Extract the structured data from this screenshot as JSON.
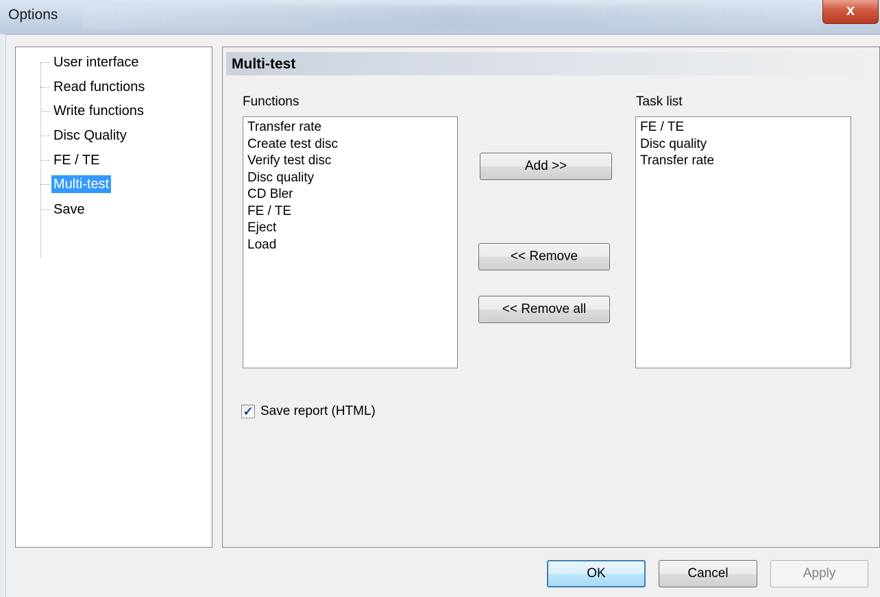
{
  "window": {
    "title": "Options",
    "close_glyph": "x"
  },
  "nav": {
    "items": [
      {
        "label": "User interface",
        "selected": false
      },
      {
        "label": "Read functions",
        "selected": false
      },
      {
        "label": "Write functions",
        "selected": false
      },
      {
        "label": "Disc Quality",
        "selected": false
      },
      {
        "label": "FE / TE",
        "selected": false
      },
      {
        "label": "Multi-test",
        "selected": true
      },
      {
        "label": "Save",
        "selected": false
      }
    ]
  },
  "page": {
    "header": "Multi-test",
    "functions_label": "Functions",
    "functions": [
      "Transfer rate",
      "Create test disc",
      "Verify test disc",
      "Disc quality",
      "CD Bler",
      "FE / TE",
      "Eject",
      "Load"
    ],
    "task_list_label": "Task list",
    "task_list": [
      "FE / TE",
      "Disc quality",
      "Transfer rate"
    ],
    "add_label": "Add >>",
    "remove_label": "<< Remove",
    "remove_all_label": "<< Remove all",
    "save_report_label": "Save report (HTML)",
    "save_report_checked": true
  },
  "footer": {
    "ok_label": "OK",
    "cancel_label": "Cancel",
    "apply_label": "Apply"
  },
  "colors": {
    "selection": "#3399ff",
    "close_button": "#c94a31",
    "default_button_border": "#3c7fb1"
  }
}
